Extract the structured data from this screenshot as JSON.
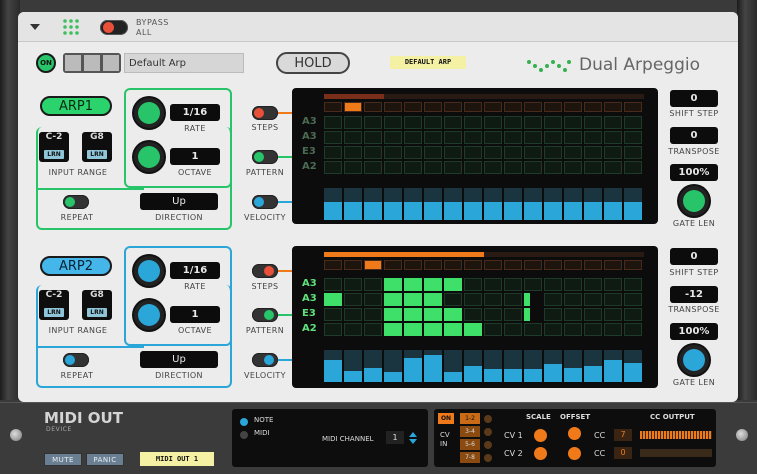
{
  "header": {
    "bypass_label": "BYPASS\nALL"
  },
  "toolbar": {
    "on_label": "ON",
    "preset_name": "Default Arp",
    "hold_label": "HOLD",
    "patch_label": "DEFAULT ARP",
    "device_title": "Dual Arpeggio"
  },
  "arp1": {
    "label": "ARP1",
    "rate": "1/16",
    "rate_label": "RATE",
    "octave": "1",
    "octave_label": "OCTAVE",
    "range_low": "C-2",
    "range_high": "G8",
    "lrn": "LRN",
    "input_range_label": "INPUT RANGE",
    "repeat_label": "REPEAT",
    "direction": "Up",
    "direction_label": "DIRECTION",
    "steps_label": "STEPS",
    "pattern_label": "PATTERN",
    "velocity_label": "VELOCITY",
    "notes": [
      "A3",
      "A3",
      "E3",
      "A2"
    ],
    "shift_step": "0",
    "shift_step_label": "SHIFT STEP",
    "transpose": "0",
    "transpose_label": "TRANSPOSE",
    "gate_len": "100%",
    "gate_len_label": "GATE LEN",
    "active_step": 2,
    "velocity": [
      0.55,
      0.55,
      0.55,
      0.55,
      0.55,
      0.55,
      0.55,
      0.55,
      0.55,
      0.55,
      0.55,
      0.55,
      0.55,
      0.55,
      0.55,
      0.55
    ],
    "pattern_on": []
  },
  "arp2": {
    "label": "ARP2",
    "rate": "1/16",
    "rate_label": "RATE",
    "octave": "1",
    "octave_label": "OCTAVE",
    "range_low": "C-2",
    "range_high": "G8",
    "lrn": "LRN",
    "input_range_label": "INPUT RANGE",
    "repeat_label": "REPEAT",
    "direction": "Up",
    "direction_label": "DIRECTION",
    "steps_label": "STEPS",
    "pattern_label": "PATTERN",
    "velocity_label": "VELOCITY",
    "notes": [
      "A3",
      "A3",
      "E3",
      "A2"
    ],
    "shift_step": "0",
    "shift_step_label": "SHIFT STEP",
    "transpose": "-12",
    "transpose_label": "TRANSPOSE",
    "gate_len": "100%",
    "gate_len_label": "GATE LEN",
    "active_step": 3,
    "velocity": [
      0.7,
      0.35,
      0.45,
      0.3,
      0.75,
      0.85,
      0.3,
      0.5,
      0.4,
      0.4,
      0.4,
      0.55,
      0.45,
      0.5,
      0.7,
      0.6
    ],
    "pattern_on": [
      [
        0,
        3
      ],
      [
        0,
        4
      ],
      [
        0,
        5
      ],
      [
        0,
        6
      ],
      [
        1,
        0
      ],
      [
        1,
        5
      ],
      [
        1,
        3
      ],
      [
        1,
        4
      ],
      [
        1,
        10
      ],
      [
        2,
        3
      ],
      [
        2,
        4
      ],
      [
        2,
        5
      ],
      [
        2,
        6
      ],
      [
        2,
        10
      ],
      [
        3,
        3
      ],
      [
        3,
        4
      ],
      [
        3,
        5
      ],
      [
        3,
        6
      ],
      [
        3,
        7
      ]
    ]
  },
  "device": {
    "name": "MIDI OUT",
    "sub": "DEVICE",
    "mute": "MUTE",
    "panic": "PANIC",
    "midi_tag": "MIDI OUT 1",
    "note": "NOTE",
    "midi": "MIDI",
    "midi_channel_label": "MIDI CHANNEL",
    "midi_channel": "1",
    "on": "ON",
    "cv_in": "CV\nIN",
    "ranges": [
      "1-2",
      "3-4",
      "5-6",
      "7-8"
    ],
    "scale": "SCALE",
    "offset": "OFFSET",
    "cc_output": "CC OUTPUT",
    "cv1": "CV 1",
    "cv2": "CV 2",
    "cc": "CC",
    "cc1": "7",
    "cc2": "0"
  },
  "colors": {
    "green": "#27c46a",
    "blue": "#2aa6d8",
    "orange": "#f07a1a",
    "red": "#e8503a"
  }
}
